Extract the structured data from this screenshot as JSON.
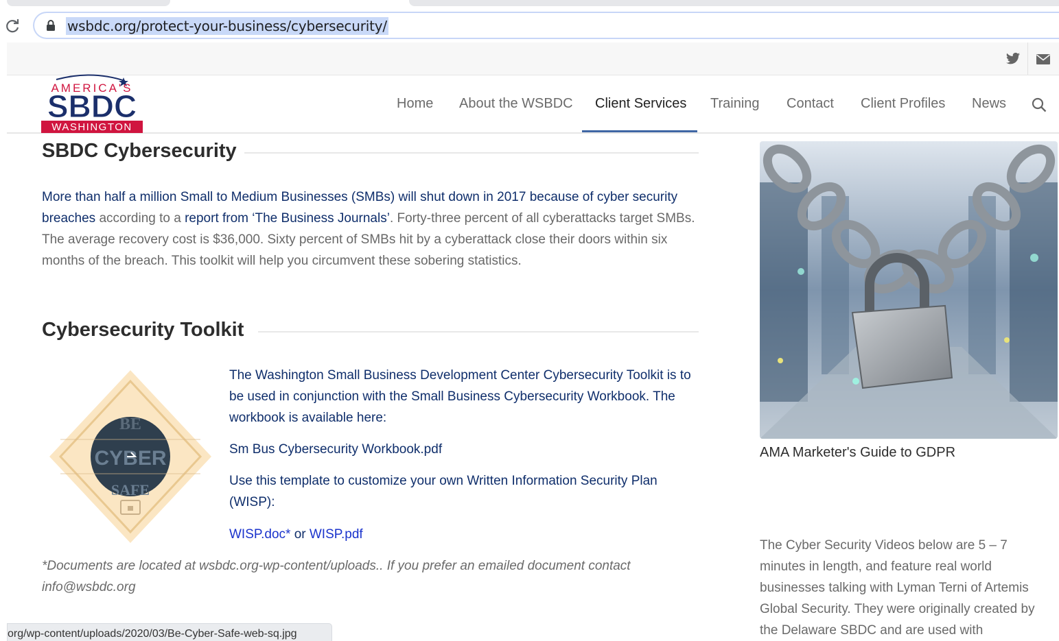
{
  "browser": {
    "url": "wsbdc.org/protect-your-business/cybersecurity/",
    "status_url": "org/wp-content/uploads/2020/03/Be-Cyber-Safe-web-sq.jpg"
  },
  "topbar": {
    "icons": [
      "twitter-icon",
      "mail-icon"
    ]
  },
  "logo": {
    "line1": "AMERICA'S",
    "line2": "SBDC",
    "line3": "WASHINGTON"
  },
  "nav": {
    "items": [
      "Home",
      "About the WSBDC",
      "Client Services",
      "Training",
      "Contact",
      "Client Profiles",
      "News"
    ],
    "active": "Client Services"
  },
  "section1": {
    "title": "SBDC Cybersecurity",
    "lead_bold": "More than half a million Small to Medium Businesses (SMBs) will shut down in 2017 because of cyber security breaches",
    "text_a": " according to a ",
    "report_link": "report from ‘The Business Journals’",
    "text_b": ". Forty-three percent of all cyberattacks target SMBs. The average recovery cost is $36,000. Sixty percent of SMBs hit by a cyberattack close their doors within six months of the breach. This toolkit will help you circumvent these sobering statistics."
  },
  "section2": {
    "title": "Cybersecurity Toolkit",
    "intro": "The Washington Small Business Development Center Cybersecurity Toolkit is to be used in conjunction with the Small Business Cybersecurity Workbook. The workbook is available here:",
    "workbook_link": "Sm Bus Cybersecurity Workbook.pdf",
    "wisp_intro": "Use this template to customize your own Written Information Security Plan (WISP):",
    "wisp_doc": "WISP.doc*",
    "wisp_or": " or ",
    "wisp_pdf": "WISP.pdf",
    "footnote": "*Documents are located at wsbdc.org-wp-content/uploads.. If you prefer an emailed document contact info@wsbdc.org",
    "badge": {
      "top": "BE",
      "mid": "CYBER",
      "bottom": "SAFE"
    }
  },
  "sidebar": {
    "caption": "AMA Marketer's Guide to GDPR",
    "text": "The Cyber Security Videos below are 5 – 7 minutes in length, and feature real world businesses talking with Lyman Terni of Artemis Global Security. They were originally created by the Delaware SBDC and are used with"
  },
  "colors": {
    "navy": "#0f2e6b",
    "link": "#1a33cc",
    "accent": "#3f66a4",
    "logo_red": "#d0153f"
  }
}
